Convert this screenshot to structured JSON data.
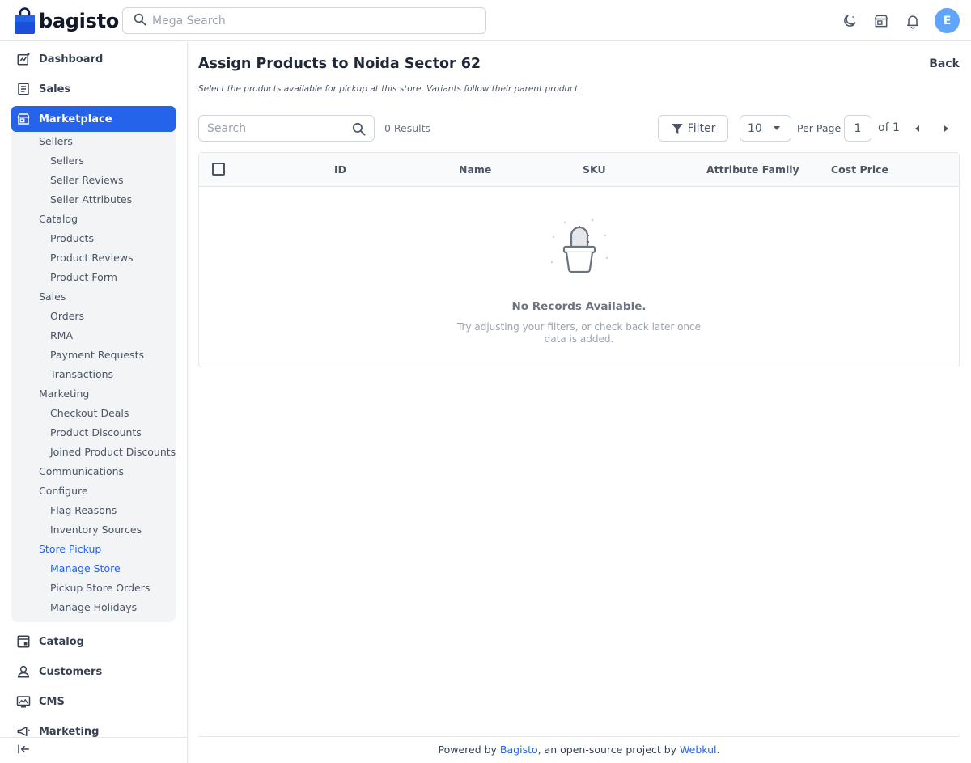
{
  "header": {
    "logo_text": "bagisto",
    "search_placeholder": "Mega Search",
    "avatar_initial": "E",
    "brand_color": "#2563eb"
  },
  "sidebar": {
    "top_before": [
      {
        "label": "Dashboard",
        "icon": "dashboard-icon"
      },
      {
        "label": "Sales",
        "icon": "receipt-icon"
      }
    ],
    "active": {
      "label": "Marketplace",
      "icon": "store-icon"
    },
    "marketplace_sub": [
      {
        "label": "Sellers",
        "level": 1
      },
      {
        "label": "Sellers",
        "level": 2
      },
      {
        "label": "Seller Reviews",
        "level": 2
      },
      {
        "label": "Seller Attributes",
        "level": 2
      },
      {
        "label": "Catalog",
        "level": 1
      },
      {
        "label": "Products",
        "level": 2
      },
      {
        "label": "Product Reviews",
        "level": 2
      },
      {
        "label": "Product Form",
        "level": 2
      },
      {
        "label": "Sales",
        "level": 1
      },
      {
        "label": "Orders",
        "level": 2
      },
      {
        "label": "RMA",
        "level": 2
      },
      {
        "label": "Payment Requests",
        "level": 2
      },
      {
        "label": "Transactions",
        "level": 2
      },
      {
        "label": "Marketing",
        "level": 1
      },
      {
        "label": "Checkout Deals",
        "level": 2
      },
      {
        "label": "Product Discounts",
        "level": 2
      },
      {
        "label": "Joined Product Discounts",
        "level": 2
      },
      {
        "label": "Communications",
        "level": 1
      },
      {
        "label": "Configure",
        "level": 1
      },
      {
        "label": "Flag Reasons",
        "level": 2
      },
      {
        "label": "Inventory Sources",
        "level": 2
      },
      {
        "label": "Store Pickup",
        "level": 1,
        "selected": true
      },
      {
        "label": "Manage Store",
        "level": 2,
        "selected": true
      },
      {
        "label": "Pickup Store Orders",
        "level": 2
      },
      {
        "label": "Manage Holidays",
        "level": 2
      }
    ],
    "top_after": [
      {
        "label": "Catalog",
        "icon": "catalog-icon"
      },
      {
        "label": "Customers",
        "icon": "person-icon"
      },
      {
        "label": "CMS",
        "icon": "monitor-icon"
      },
      {
        "label": "Marketing",
        "icon": "megaphone-icon"
      }
    ]
  },
  "page": {
    "title": "Assign Products to Noida Sector 62",
    "back_label": "Back",
    "description": "Select the products available for pickup at this store. Variants follow their parent product."
  },
  "toolbar": {
    "search_placeholder": "Search",
    "results": "0 Results",
    "filter_label": "Filter",
    "per_page_value": "10",
    "per_page_label": "Per Page",
    "page_value": "1",
    "page_of": "of 1"
  },
  "grid": {
    "columns": [
      "ID",
      "Name",
      "SKU",
      "Attribute Family",
      "Cost Price"
    ],
    "empty_title": "No Records Available.",
    "empty_message": "Try adjusting your filters, or check back later once data is added."
  },
  "footer": {
    "prefix": "Powered by ",
    "link1": "Bagisto",
    "middle": ", an open-source project by ",
    "link2": "Webkul",
    "suffix": "."
  }
}
